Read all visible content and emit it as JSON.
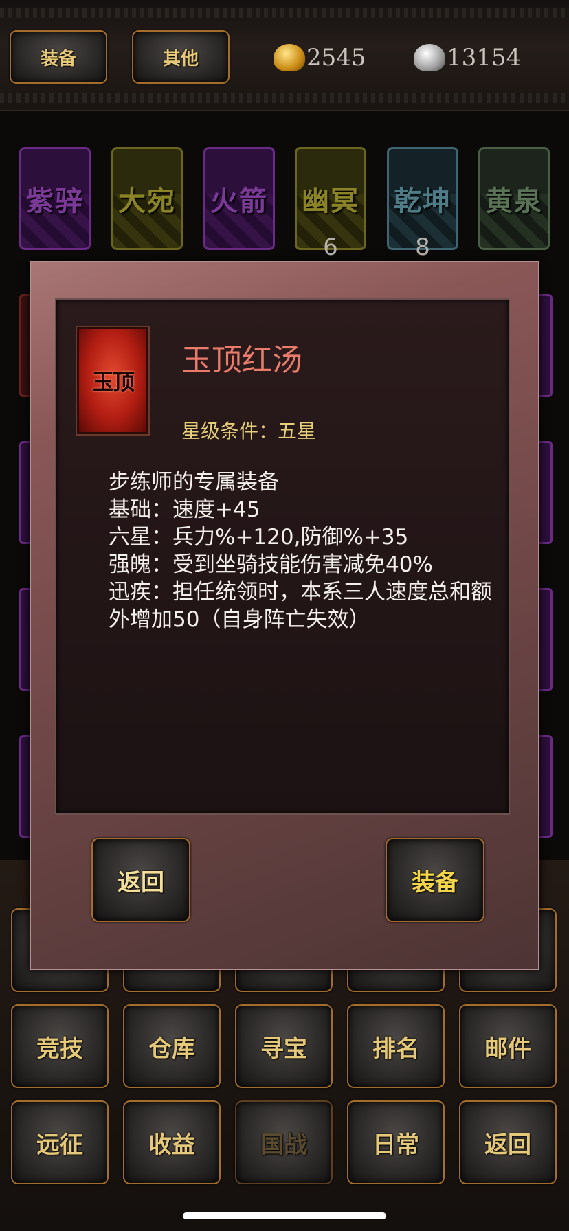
{
  "top": {
    "tab_equip": "装备",
    "tab_other": "其他",
    "gold": "2545",
    "silver": "13154"
  },
  "horses": [
    {
      "name": "紫骍",
      "color": "purple",
      "count": ""
    },
    {
      "name": "大宛",
      "color": "olive",
      "count": ""
    },
    {
      "name": "火箭",
      "color": "purple",
      "count": ""
    },
    {
      "name": "幽冥",
      "color": "olive",
      "count": "6"
    },
    {
      "name": "乾坤",
      "color": "blue",
      "count": "8"
    },
    {
      "name": "黄泉",
      "color": "green",
      "count": ""
    }
  ],
  "modal": {
    "icon_text": "玉顶",
    "item_name": "玉顶红汤",
    "star_condition": "星级条件：五星",
    "description": [
      "步练师的专属装备",
      "基础：速度+45",
      "六星：兵力%+120,防御%+35",
      "强魄：受到坐骑技能伤害减免40%",
      "迅疾：担任统领时，本系三人速度总和额外增加50（自身阵亡失效）"
    ],
    "back_button": "返回",
    "equip_button": "装备"
  },
  "menu": {
    "row2": [
      "竞技",
      "仓库",
      "寻宝",
      "排名",
      "邮件"
    ],
    "row3": [
      "远征",
      "收益",
      "国战",
      "日常",
      "返回"
    ]
  },
  "colors": {
    "button_border": "#a56d2c",
    "button_text": "#e5c878",
    "item_name": "#ea7a6a",
    "star_text": "#e6cf79"
  }
}
